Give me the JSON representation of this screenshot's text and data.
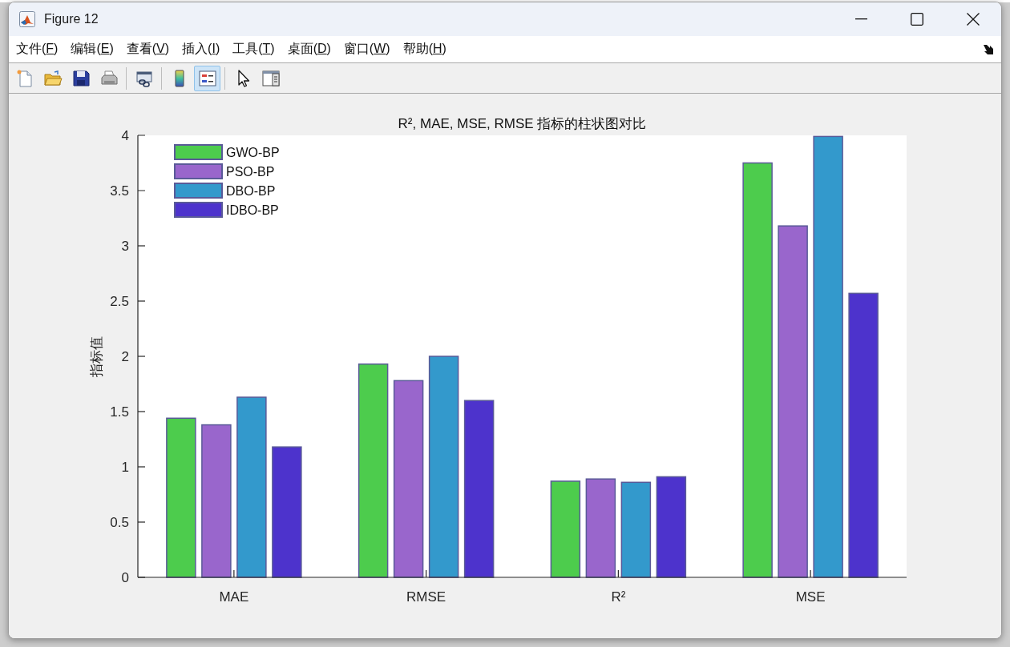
{
  "window": {
    "title": "Figure 12"
  },
  "menu": [
    "文件(F)",
    "编辑(E)",
    "查看(V)",
    "插入(I)",
    "工具(T)",
    "桌面(D)",
    "窗口(W)",
    "帮助(H)"
  ],
  "toolbar": {
    "groups": [
      [
        {
          "kind": "new",
          "pressed": false
        },
        {
          "kind": "open",
          "pressed": false
        },
        {
          "kind": "save",
          "pressed": false
        },
        {
          "kind": "print",
          "pressed": false
        }
      ],
      [
        {
          "kind": "link",
          "pressed": false
        }
      ],
      [
        {
          "kind": "colorbar",
          "pressed": false
        },
        {
          "kind": "legend",
          "pressed": true
        }
      ],
      [
        {
          "kind": "pointer",
          "pressed": false
        },
        {
          "kind": "inspector",
          "pressed": false
        }
      ]
    ]
  },
  "figure": {
    "chart_data": {
      "type": "bar",
      "title": "R², MAE, MSE, RMSE 指标的柱状图对比",
      "ylabel": "指标值",
      "categories": [
        "MAE",
        "RMSE",
        "R²",
        "MSE"
      ],
      "series": [
        {
          "name": "GWO-BP",
          "color": "#4dcc4d",
          "values": [
            1.44,
            1.93,
            0.87,
            3.75
          ]
        },
        {
          "name": "PSO-BP",
          "color": "#9966cc",
          "values": [
            1.38,
            1.78,
            0.89,
            3.18
          ]
        },
        {
          "name": "DBO-BP",
          "color": "#3399cc",
          "values": [
            1.63,
            2.0,
            0.86,
            3.99
          ]
        },
        {
          "name": "IDBO-BP",
          "color": "#4d33cc",
          "values": [
            1.18,
            1.6,
            0.91,
            2.57
          ]
        }
      ],
      "ylim": [
        0,
        4
      ],
      "yticks": [
        0,
        0.5,
        1,
        1.5,
        2,
        2.5,
        3,
        3.5,
        4
      ],
      "legend": true
    }
  }
}
